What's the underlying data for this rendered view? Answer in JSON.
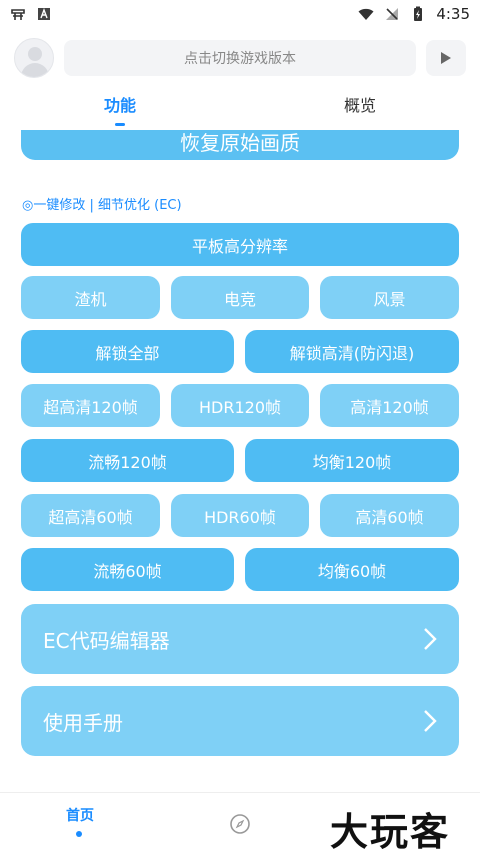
{
  "status_bar": {
    "time": "4:35"
  },
  "top": {
    "version_placeholder": "点击切换游戏版本"
  },
  "tabs": [
    {
      "label": "功能",
      "active": true
    },
    {
      "label": "概览",
      "active": false
    }
  ],
  "restore_button": "恢复原始画质",
  "section_label": "◎一键修改 | 细节优化 (EC)",
  "buttons": {
    "tablet_resolution": "平板高分辨率",
    "row_quality": [
      "渣机",
      "电竞",
      "风景"
    ],
    "unlock_all": "解锁全部",
    "unlock_hd": "解锁高清(防闪退)",
    "fps120_a": [
      "超高清120帧",
      "HDR120帧",
      "高清120帧"
    ],
    "fps120_b": [
      "流畅120帧",
      "均衡120帧"
    ],
    "fps60_a": [
      "超高清60帧",
      "HDR60帧",
      "高清60帧"
    ],
    "fps60_b": [
      "流畅60帧",
      "均衡60帧"
    ]
  },
  "menu_rows": [
    {
      "label": "EC代码编辑器"
    },
    {
      "label": "使用手册"
    }
  ],
  "bottom_nav": {
    "home_label": "首页"
  },
  "watermark": "大玩客",
  "colors": {
    "accent": "#1a8cff",
    "button_dark": "#4fbcf3",
    "button_light": "#7fd0f6"
  }
}
